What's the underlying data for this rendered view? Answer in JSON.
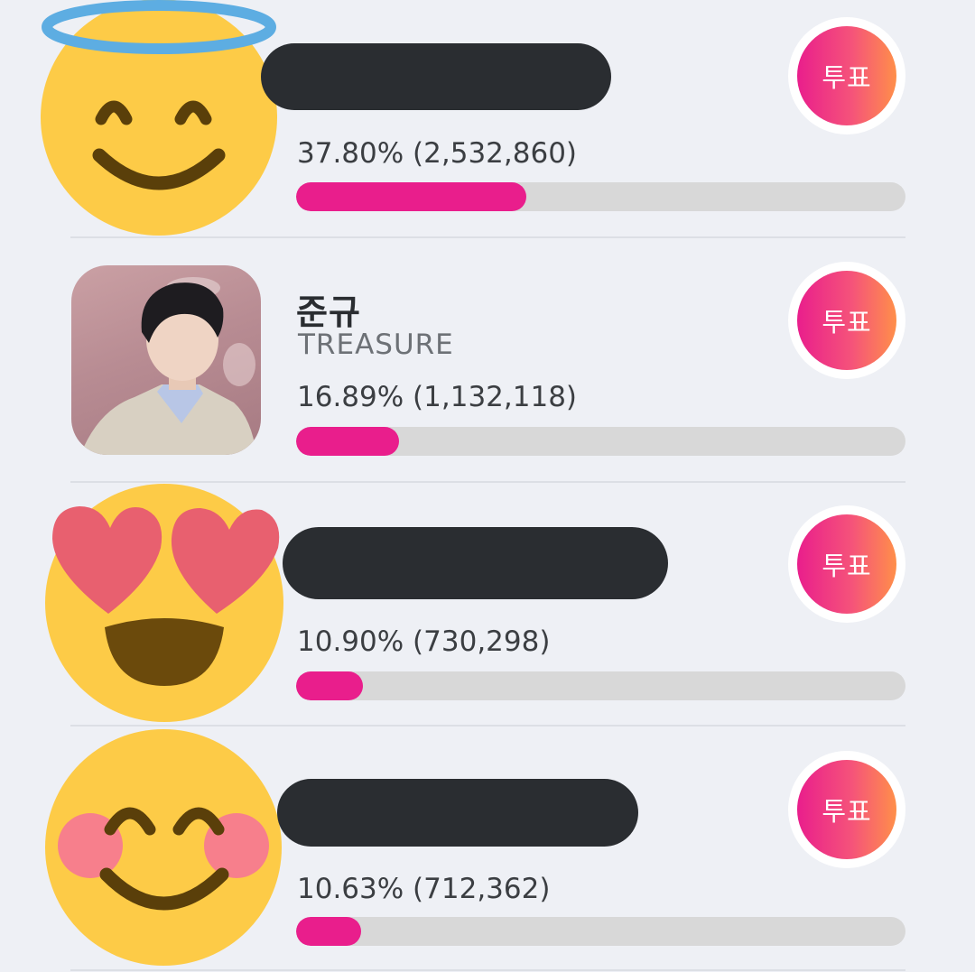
{
  "vote_label": "투표",
  "candidates": [
    {
      "name": "",
      "group": "",
      "percent_text": "37.80% (2,532,860)",
      "share": 0.378,
      "avatar": "smiling-face-with-halo-icon"
    },
    {
      "name": "준규",
      "group": "TREASURE",
      "percent_text": "16.89% (1,132,118)",
      "share": 0.1689,
      "avatar": "profile-photo"
    },
    {
      "name": "",
      "group": "",
      "percent_text": "10.90% (730,298)",
      "share": 0.109,
      "avatar": "heart-eyes-face-icon"
    },
    {
      "name": "",
      "group": "",
      "percent_text": "10.63% (712,362)",
      "share": 0.1063,
      "avatar": "smiling-face-with-blush-icon"
    }
  ],
  "colors": {
    "background": "#eef0f5",
    "bar_fill": "#e91e8c",
    "bar_track": "#d8d8d8",
    "vote_gradient_start": "#e91e8c",
    "vote_gradient_end": "#ff8f4a",
    "redaction": "#2a2d31"
  }
}
